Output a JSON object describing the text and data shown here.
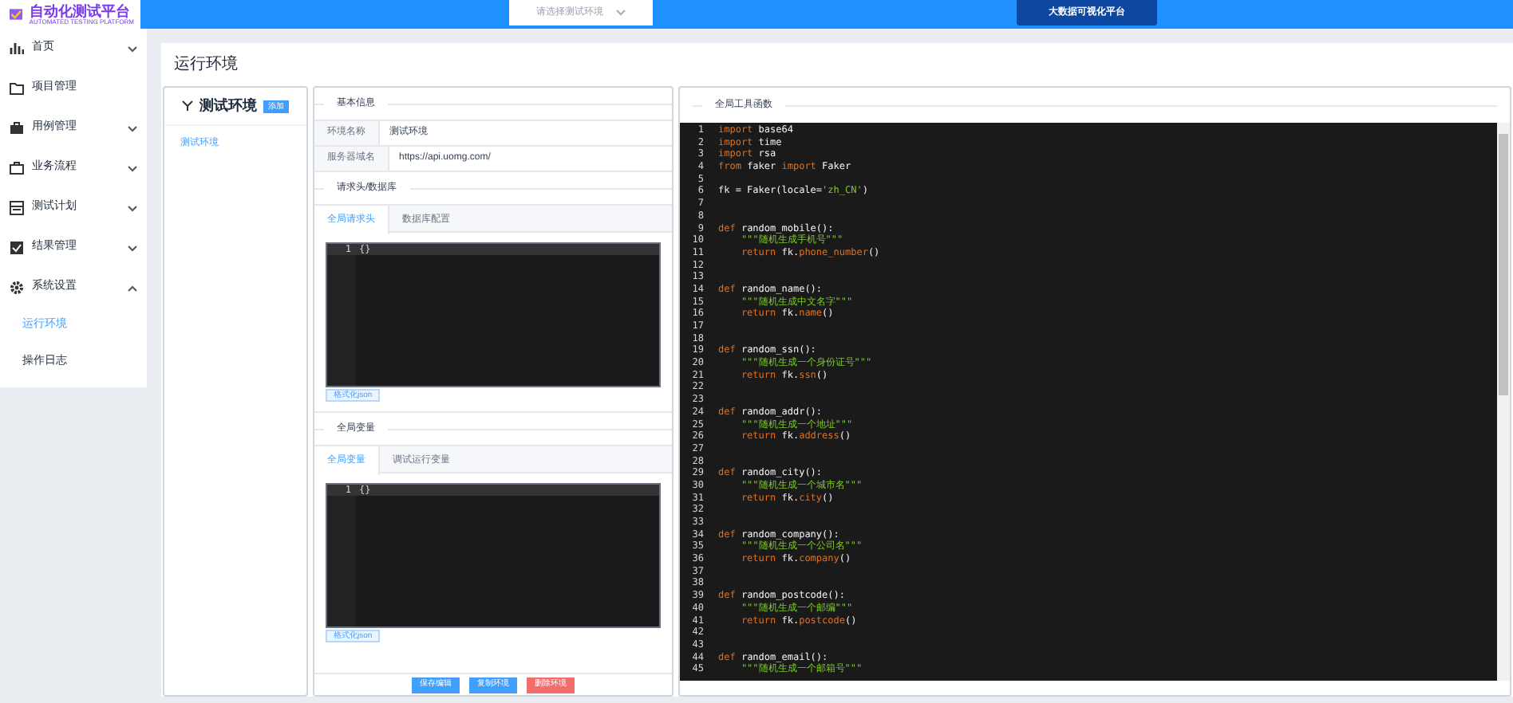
{
  "header": {
    "logo_title": "自动化测试平台",
    "logo_subtitle": "AUTOMATED TESTING PLATFORM",
    "env_select": {
      "placeholder": "请选择测试环境"
    },
    "nav_button": "大数据可视化平台"
  },
  "sidebar": {
    "items": [
      {
        "label": "首页",
        "expanded": false,
        "has_arrow": true
      },
      {
        "label": "项目管理",
        "has_arrow": false
      },
      {
        "label": "用例管理",
        "expanded": false,
        "has_arrow": true
      },
      {
        "label": "业务流程",
        "expanded": false,
        "has_arrow": true
      },
      {
        "label": "测试计划",
        "expanded": false,
        "has_arrow": true
      },
      {
        "label": "结果管理",
        "expanded": false,
        "has_arrow": true
      },
      {
        "label": "系统设置",
        "expanded": true,
        "has_arrow": true,
        "children": [
          {
            "label": "运行环境",
            "selected": true
          },
          {
            "label": "操作日志",
            "selected": false
          }
        ]
      }
    ]
  },
  "page": {
    "title": "运行环境"
  },
  "env_list": {
    "title": "测试环境",
    "add_button": "添加",
    "items": [
      {
        "label": "测试环境",
        "selected": true
      }
    ]
  },
  "env_form": {
    "basic_heading": "基本信息",
    "fields": [
      {
        "label": "环境名称",
        "value": "测试环境"
      },
      {
        "label": "服务器域名",
        "value": "https://api.uomg.com/"
      }
    ],
    "sections": [
      {
        "heading": "请求头/数据库",
        "tabs": [
          {
            "label": "全局请求头",
            "selected": true
          },
          {
            "label": "数据库配置",
            "selected": false
          }
        ],
        "editor_lines": [
          {
            "number": "1",
            "text": "{}"
          }
        ],
        "format_button": "格式化json"
      },
      {
        "heading": "全局变量",
        "tabs": [
          {
            "label": "全局变量",
            "selected": true
          },
          {
            "label": "调试运行变量",
            "selected": false
          }
        ],
        "editor_lines": [
          {
            "number": "1",
            "text": "{}"
          }
        ],
        "format_button": "格式化json"
      }
    ],
    "buttons": [
      {
        "label": "保存编辑",
        "kind": "primary"
      },
      {
        "label": "复制环境",
        "kind": "primary"
      },
      {
        "label": "删除环境",
        "kind": "danger"
      }
    ]
  },
  "functions": {
    "heading": "全局工具函数",
    "lines": [
      {
        "number": "1",
        "tokens": [
          {
            "kind": "keyword",
            "text": "import"
          },
          {
            "kind": "plain",
            "text": " base64"
          }
        ]
      },
      {
        "number": "2",
        "tokens": [
          {
            "kind": "keyword",
            "text": "import"
          },
          {
            "kind": "plain",
            "text": " time"
          }
        ]
      },
      {
        "number": "3",
        "tokens": [
          {
            "kind": "keyword",
            "text": "import"
          },
          {
            "kind": "plain",
            "text": " rsa"
          }
        ]
      },
      {
        "number": "4",
        "tokens": [
          {
            "kind": "keyword",
            "text": "from"
          },
          {
            "kind": "plain",
            "text": " faker "
          },
          {
            "kind": "keyword",
            "text": "import"
          },
          {
            "kind": "plain",
            "text": " Faker"
          }
        ]
      },
      {
        "number": "5"
      },
      {
        "number": "6",
        "tokens": [
          {
            "kind": "plain",
            "text": "fk = Faker(locale="
          },
          {
            "kind": "string",
            "text": "'zh_CN'"
          },
          {
            "kind": "plain",
            "text": ")"
          }
        ]
      },
      {
        "number": "7"
      },
      {
        "number": "8"
      },
      {
        "number": "9",
        "tokens": [
          {
            "kind": "keyword",
            "text": "def"
          },
          {
            "kind": "plain",
            "text": " random_mobile():"
          }
        ]
      },
      {
        "number": "10",
        "tokens": [
          {
            "kind": "string",
            "text": "    \"\"\"随机生成手机号\"\"\""
          }
        ]
      },
      {
        "number": "11",
        "tokens": [
          {
            "kind": "keyword",
            "text": "    return"
          },
          {
            "kind": "plain",
            "text": " fk."
          },
          {
            "kind": "call",
            "text": "phone_number"
          },
          {
            "kind": "plain",
            "text": "()"
          }
        ]
      },
      {
        "number": "12"
      },
      {
        "number": "13"
      },
      {
        "number": "14",
        "tokens": [
          {
            "kind": "keyword",
            "text": "def"
          },
          {
            "kind": "plain",
            "text": " random_name():"
          }
        ]
      },
      {
        "number": "15",
        "tokens": [
          {
            "kind": "string",
            "text": "    \"\"\"随机生成中文名字\"\"\""
          }
        ]
      },
      {
        "number": "16",
        "tokens": [
          {
            "kind": "keyword",
            "text": "    return"
          },
          {
            "kind": "plain",
            "text": " fk."
          },
          {
            "kind": "call",
            "text": "name"
          },
          {
            "kind": "plain",
            "text": "()"
          }
        ]
      },
      {
        "number": "17"
      },
      {
        "number": "18"
      },
      {
        "number": "19",
        "tokens": [
          {
            "kind": "keyword",
            "text": "def"
          },
          {
            "kind": "plain",
            "text": " random_ssn():"
          }
        ]
      },
      {
        "number": "20",
        "tokens": [
          {
            "kind": "string",
            "text": "    \"\"\"随机生成一个身份证号\"\"\""
          }
        ]
      },
      {
        "number": "21",
        "tokens": [
          {
            "kind": "keyword",
            "text": "    return"
          },
          {
            "kind": "plain",
            "text": " fk."
          },
          {
            "kind": "call",
            "text": "ssn"
          },
          {
            "kind": "plain",
            "text": "()"
          }
        ]
      },
      {
        "number": "22"
      },
      {
        "number": "23"
      },
      {
        "number": "24",
        "tokens": [
          {
            "kind": "keyword",
            "text": "def"
          },
          {
            "kind": "plain",
            "text": " random_addr():"
          }
        ]
      },
      {
        "number": "25",
        "tokens": [
          {
            "kind": "string",
            "text": "    \"\"\"随机生成一个地址\"\"\""
          }
        ]
      },
      {
        "number": "26",
        "tokens": [
          {
            "kind": "keyword",
            "text": "    return"
          },
          {
            "kind": "plain",
            "text": " fk."
          },
          {
            "kind": "call",
            "text": "address"
          },
          {
            "kind": "plain",
            "text": "()"
          }
        ]
      },
      {
        "number": "27"
      },
      {
        "number": "28"
      },
      {
        "number": "29",
        "tokens": [
          {
            "kind": "keyword",
            "text": "def"
          },
          {
            "kind": "plain",
            "text": " random_city():"
          }
        ]
      },
      {
        "number": "30",
        "tokens": [
          {
            "kind": "string",
            "text": "    \"\"\"随机生成一个城市名\"\"\""
          }
        ]
      },
      {
        "number": "31",
        "tokens": [
          {
            "kind": "keyword",
            "text": "    return"
          },
          {
            "kind": "plain",
            "text": " fk."
          },
          {
            "kind": "call",
            "text": "city"
          },
          {
            "kind": "plain",
            "text": "()"
          }
        ]
      },
      {
        "number": "32"
      },
      {
        "number": "33"
      },
      {
        "number": "34",
        "tokens": [
          {
            "kind": "keyword",
            "text": "def"
          },
          {
            "kind": "plain",
            "text": " random_company():"
          }
        ]
      },
      {
        "number": "35",
        "tokens": [
          {
            "kind": "string",
            "text": "    \"\"\"随机生成一个公司名\"\"\""
          }
        ]
      },
      {
        "number": "36",
        "tokens": [
          {
            "kind": "keyword",
            "text": "    return"
          },
          {
            "kind": "plain",
            "text": " fk."
          },
          {
            "kind": "call",
            "text": "company"
          },
          {
            "kind": "plain",
            "text": "()"
          }
        ]
      },
      {
        "number": "37"
      },
      {
        "number": "38"
      },
      {
        "number": "39",
        "tokens": [
          {
            "kind": "keyword",
            "text": "def"
          },
          {
            "kind": "plain",
            "text": " random_postcode():"
          }
        ]
      },
      {
        "number": "40",
        "tokens": [
          {
            "kind": "string",
            "text": "    \"\"\"随机生成一个邮编\"\"\""
          }
        ]
      },
      {
        "number": "41",
        "tokens": [
          {
            "kind": "keyword",
            "text": "    return"
          },
          {
            "kind": "plain",
            "text": " fk."
          },
          {
            "kind": "call",
            "text": "postcode"
          },
          {
            "kind": "plain",
            "text": "()"
          }
        ]
      },
      {
        "number": "42"
      },
      {
        "number": "43"
      },
      {
        "number": "44",
        "tokens": [
          {
            "kind": "keyword",
            "text": "def"
          },
          {
            "kind": "plain",
            "text": " random_email():"
          }
        ]
      },
      {
        "number": "45",
        "tokens": [
          {
            "kind": "string",
            "text": "    \"\"\"随机生成一个邮箱号\"\"\""
          }
        ]
      }
    ]
  }
}
